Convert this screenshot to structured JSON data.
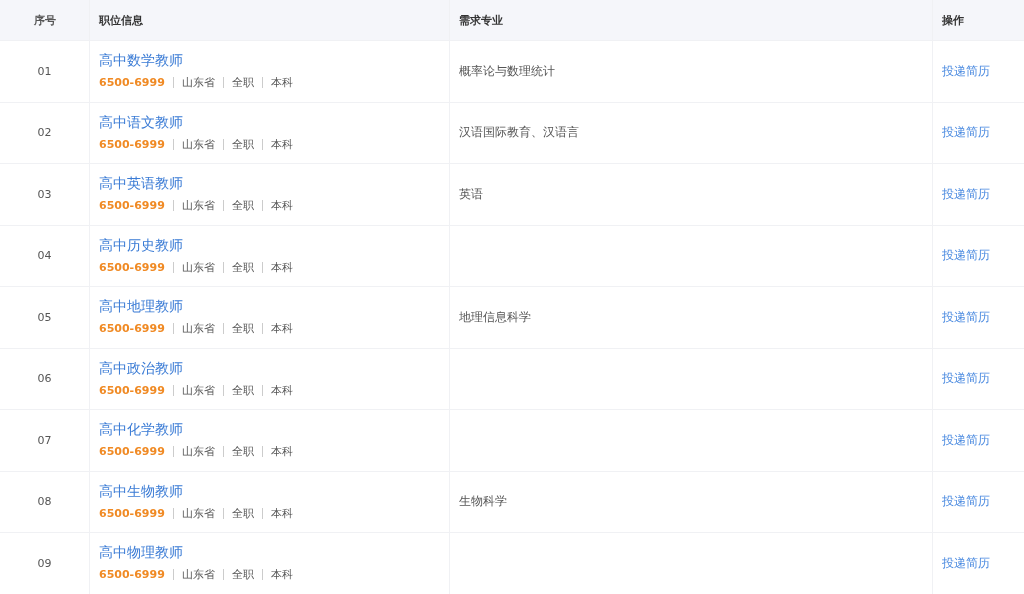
{
  "columns": [
    "序号",
    "职位信息",
    "需求专业",
    "操作"
  ],
  "rows": [
    {
      "index": "01",
      "title": "高中数学教师",
      "salary": "6500-6999",
      "location": "山东省",
      "job_type": "全职",
      "education": "本科",
      "major": "概率论与数理统计",
      "action": "投递简历"
    },
    {
      "index": "02",
      "title": "高中语文教师",
      "salary": "6500-6999",
      "location": "山东省",
      "job_type": "全职",
      "education": "本科",
      "major": "汉语国际教育、汉语言",
      "action": "投递简历"
    },
    {
      "index": "03",
      "title": "高中英语教师",
      "salary": "6500-6999",
      "location": "山东省",
      "job_type": "全职",
      "education": "本科",
      "major": "英语",
      "action": "投递简历"
    },
    {
      "index": "04",
      "title": "高中历史教师",
      "salary": "6500-6999",
      "location": "山东省",
      "job_type": "全职",
      "education": "本科",
      "action": "投递简历"
    },
    {
      "index": "05",
      "title": "高中地理教师",
      "salary": "6500-6999",
      "location": "山东省",
      "job_type": "全职",
      "education": "本科",
      "major": "地理信息科学",
      "action": "投递简历"
    },
    {
      "index": "06",
      "title": "高中政治教师",
      "salary": "6500-6999",
      "location": "山东省",
      "job_type": "全职",
      "education": "本科",
      "action": "投递简历"
    },
    {
      "index": "07",
      "title": "高中化学教师",
      "salary": "6500-6999",
      "location": "山东省",
      "job_type": "全职",
      "education": "本科",
      "action": "投递简历"
    },
    {
      "index": "08",
      "title": "高中生物教师",
      "salary": "6500-6999",
      "location": "山东省",
      "job_type": "全职",
      "education": "本科",
      "major": "生物科学",
      "action": "投递简历"
    },
    {
      "index": "09",
      "title": "高中物理教师",
      "salary": "6500-6999",
      "location": "山东省",
      "job_type": "全职",
      "education": "本科",
      "action": "投递简历"
    }
  ]
}
